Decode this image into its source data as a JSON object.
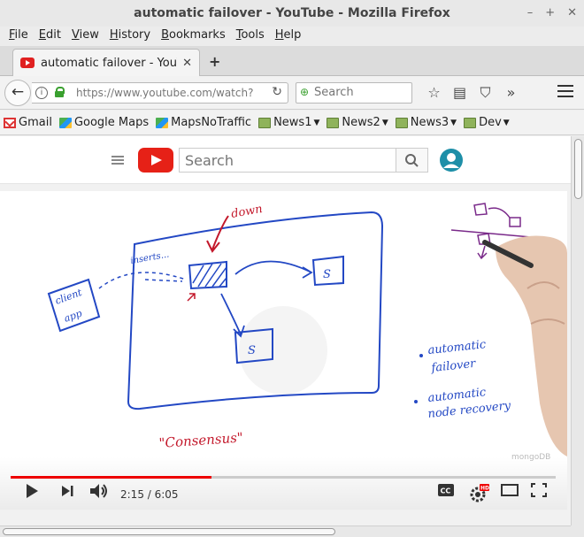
{
  "window": {
    "title": "automatic failover - YouTube - Mozilla Firefox",
    "controls": [
      "–",
      "+",
      "✕"
    ]
  },
  "menu": [
    {
      "label": "File",
      "key": "F",
      "rest": "ile"
    },
    {
      "label": "Edit",
      "key": "E",
      "rest": "dit"
    },
    {
      "label": "View",
      "key": "V",
      "rest": "iew"
    },
    {
      "label": "History",
      "key": "H",
      "rest": "istory"
    },
    {
      "label": "Bookmarks",
      "key": "B",
      "rest": "ookmarks"
    },
    {
      "label": "Tools",
      "key": "T",
      "rest": "ools"
    },
    {
      "label": "Help",
      "key": "H",
      "rest": "elp"
    }
  ],
  "tab": {
    "title": "automatic failover - YouT",
    "close": "✕",
    "new_tab": "+"
  },
  "navbar": {
    "back": "←",
    "url": "https://www.youtube.com/watch?",
    "reload": "↻",
    "search_placeholder": "Search",
    "icons": [
      "star-icon",
      "reading-list-icon",
      "pocket-icon",
      "overflow-icon"
    ]
  },
  "bookmarks": [
    {
      "label": "Gmail",
      "icon": "gmail-icon",
      "folder": false
    },
    {
      "label": "Google Maps",
      "icon": "maps-icon",
      "folder": false
    },
    {
      "label": "MapsNoTraffic",
      "icon": "maps-icon",
      "folder": false
    },
    {
      "label": "News1",
      "icon": "folder-icon",
      "folder": true
    },
    {
      "label": "News2",
      "icon": "folder-icon",
      "folder": true
    },
    {
      "label": "News3",
      "icon": "folder-icon",
      "folder": true
    },
    {
      "label": "Dev",
      "icon": "folder-icon",
      "folder": true
    }
  ],
  "youtube": {
    "search_placeholder": "Search",
    "logo": "youtube-logo",
    "avatar": "account-avatar"
  },
  "video": {
    "sketch_text": {
      "down": "down",
      "inserts": "inserts...",
      "client_app": [
        "client",
        "app"
      ],
      "s1": "S",
      "s2": "S",
      "bullet1": [
        "automatic",
        "failover"
      ],
      "bullet2": [
        "automatic",
        "node recovery"
      ],
      "consensus": "\"Consensus\""
    },
    "watermark": "mongoDB",
    "time_current": "2:15",
    "time_total": "6:05",
    "time_display": "2:15 / 6:05",
    "progress_fraction": 0.369,
    "colors": {
      "ink_blue": "#2348c4",
      "ink_red": "#c3182b",
      "ink_purple": "#7a2a8a",
      "progress_red": "#ee0000"
    }
  }
}
